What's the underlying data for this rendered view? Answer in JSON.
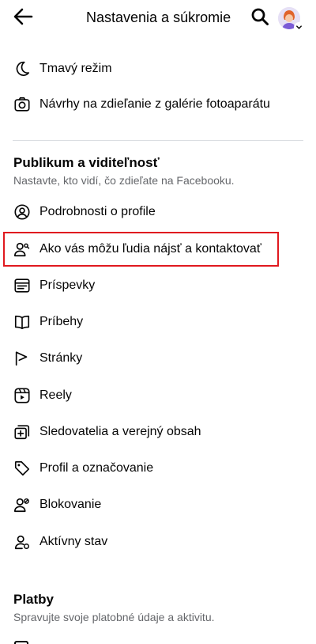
{
  "header": {
    "title": "Nastavenia a súkromie",
    "back_icon": "arrow-left-icon",
    "search_icon": "search-icon",
    "avatar_icon": "profile-avatar"
  },
  "top_items": [
    {
      "label": "Tmavý režim",
      "icon": "moon-icon"
    },
    {
      "label": "Návrhy na zdieľanie z galérie fotoaparátu",
      "icon": "camera-icon"
    }
  ],
  "audience": {
    "title": "Publikum a viditeľnosť",
    "subtitle": "Nastavte, kto vidí, čo zdieľate na Facebooku.",
    "items": [
      {
        "label": "Podrobnosti o profile",
        "icon": "profile-circle-icon"
      },
      {
        "label": "Ako vás môžu ľudia nájsť a kontaktovať",
        "icon": "person-search-icon"
      },
      {
        "label": "Príspevky",
        "icon": "posts-icon"
      },
      {
        "label": "Príbehy",
        "icon": "book-icon"
      },
      {
        "label": "Stránky",
        "icon": "flag-icon"
      },
      {
        "label": "Reely",
        "icon": "reels-icon"
      },
      {
        "label": "Sledovatelia a verejný obsah",
        "icon": "followers-icon"
      },
      {
        "label": "Profil a označovanie",
        "icon": "tag-icon"
      },
      {
        "label": "Blokovanie",
        "icon": "block-user-icon"
      },
      {
        "label": "Aktívny stav",
        "icon": "active-status-icon"
      }
    ]
  },
  "payments": {
    "title": "Platby",
    "subtitle": "Spravujte svoje platobné údaje a aktivitu."
  },
  "colors": {
    "highlight": "#e0191f",
    "text": "#050505",
    "secondary_text": "#65676b"
  }
}
